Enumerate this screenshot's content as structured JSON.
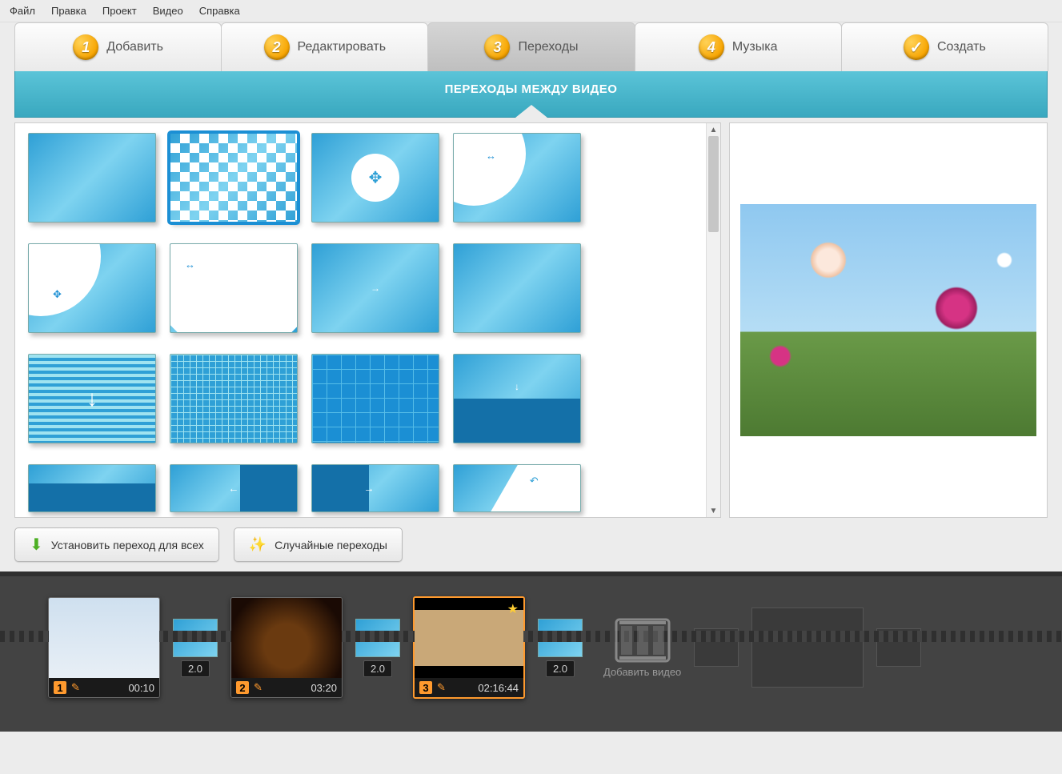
{
  "menu": {
    "items": [
      "Файл",
      "Правка",
      "Проект",
      "Видео",
      "Справка"
    ]
  },
  "tabs": {
    "t1": {
      "num": "1",
      "label": "Добавить"
    },
    "t2": {
      "num": "2",
      "label": "Редактировать"
    },
    "t3": {
      "num": "3",
      "label": "Переходы"
    },
    "t4": {
      "num": "4",
      "label": "Музыка"
    },
    "t5": {
      "num": "✓",
      "label": "Создать"
    }
  },
  "section_title": "ПЕРЕХОДЫ МЕЖДУ ВИДЕО",
  "buttons": {
    "apply_all": "Установить переход для всех",
    "random": "Случайные переходы"
  },
  "timeline": {
    "clips": [
      {
        "index": "1",
        "duration": "00:10"
      },
      {
        "index": "2",
        "duration": "03:20"
      },
      {
        "index": "3",
        "duration": "02:16:44"
      }
    ],
    "transition_duration": "2.0",
    "add_label": "Добавить видео"
  }
}
